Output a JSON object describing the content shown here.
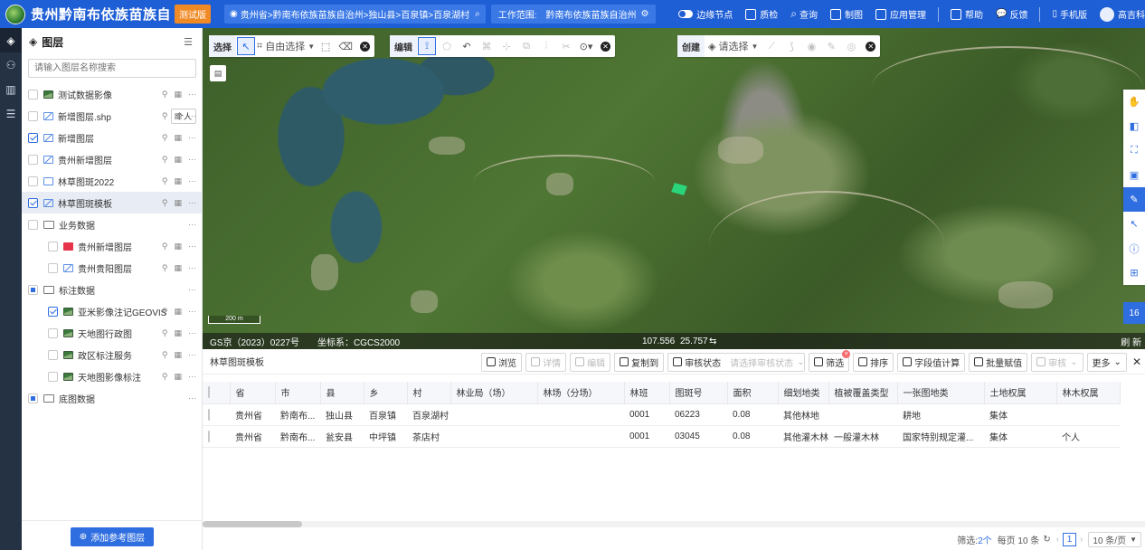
{
  "header": {
    "app_title": "贵州黔南布依族苗族自",
    "test_badge": "测试版",
    "region_path": "贵州省>黔南布依族苗族自治州>独山县>百泉镇>百泉湖村",
    "work_scope_label": "工作范围:",
    "work_scope_value": "黔南布依族苗族自治州",
    "edge_node_label": "边缘节点",
    "menu": [
      "质检",
      "查询",
      "制图",
      "应用管理"
    ],
    "help": "帮助",
    "feedback": "反馈",
    "mobile": "手机版",
    "user": "高吉科"
  },
  "layer_panel": {
    "title": "图层",
    "search_placeholder": "请输入图层名称搜索",
    "layers": [
      {
        "name": "测试数据影像",
        "checked": false,
        "icon": "image",
        "indent": 0
      },
      {
        "name": "新增图层.shp",
        "checked": false,
        "icon": "vector",
        "indent": 0,
        "tag": "个人"
      },
      {
        "name": "新增图层",
        "checked": true,
        "icon": "vector",
        "indent": 0
      },
      {
        "name": "贵州新增图层",
        "checked": false,
        "icon": "vector",
        "indent": 0
      },
      {
        "name": "林草图斑2022",
        "checked": false,
        "icon": "plain",
        "indent": 0
      },
      {
        "name": "林草图斑模板",
        "checked": true,
        "icon": "vector",
        "indent": 0,
        "selected": true
      },
      {
        "name": "业务数据",
        "checked": false,
        "icon": "folder",
        "indent": 0,
        "group": true
      },
      {
        "name": "贵州新增图层",
        "checked": false,
        "icon": "red",
        "indent": 1
      },
      {
        "name": "贵州贵阳图层",
        "checked": false,
        "icon": "vector",
        "indent": 1
      },
      {
        "name": "标注数据",
        "checked": "partial",
        "icon": "folder",
        "indent": 0,
        "group": true
      },
      {
        "name": "亚米影像注记GEOVIS",
        "checked": true,
        "icon": "image",
        "indent": 1
      },
      {
        "name": "天地图行政图",
        "checked": false,
        "icon": "image",
        "indent": 1
      },
      {
        "name": "政区标注服务",
        "checked": false,
        "icon": "image",
        "indent": 1
      },
      {
        "name": "天地图影像标注",
        "checked": false,
        "icon": "image",
        "indent": 1
      },
      {
        "name": "底图数据",
        "checked": "partial",
        "icon": "folder",
        "indent": 0,
        "group": true
      }
    ],
    "add_ref_button": "添加参考图层"
  },
  "map_toolbar": {
    "select_label": "选择",
    "free_select": "自由选择",
    "edit_label": "编辑",
    "create_label": "创建",
    "create_select": "请选择"
  },
  "map_status": {
    "scale": "200 m",
    "license": "GS京（2023）0227号",
    "crs": "坐标系：CGCS2000",
    "lon": "107.556",
    "lat": "25.757",
    "right_text": "刷 新"
  },
  "right_tools": {
    "badge": "16"
  },
  "table_panel": {
    "title": "林草图斑模板",
    "actions": [
      {
        "label": "浏览",
        "disabled": false
      },
      {
        "label": "详情",
        "disabled": true
      },
      {
        "label": "编辑",
        "disabled": true
      },
      {
        "label": "复制到",
        "disabled": false
      },
      {
        "label": "审核状态",
        "disabled": false
      },
      {
        "label": "请选择审核状态",
        "disabled": true
      },
      {
        "label": "筛选",
        "disabled": false
      },
      {
        "label": "排序",
        "disabled": false
      },
      {
        "label": "字段值计算",
        "disabled": false
      },
      {
        "label": "批量赋值",
        "disabled": false
      },
      {
        "label": "审核",
        "disabled": true
      },
      {
        "label": "更多",
        "disabled": false
      }
    ],
    "filter_badge": "×",
    "columns": [
      "省",
      "市",
      "县",
      "乡",
      "村",
      "林业局（场）",
      "林场（分场）",
      "林班",
      "图斑号",
      "面积",
      "细划地类",
      "植被覆盖类型",
      "一张图地类",
      "土地权属",
      "林木权属"
    ],
    "rows": [
      [
        "贵州省",
        "黔南布...",
        "独山县",
        "百泉镇",
        "百泉湖村",
        "",
        "",
        "0001",
        "06223",
        "0.08",
        "其他林地",
        "",
        "耕地",
        "集体",
        ""
      ],
      [
        "贵州省",
        "黔南布...",
        "瓮安县",
        "中坪镇",
        "茶店村",
        "",
        "",
        "0001",
        "03045",
        "0.08",
        "其他灌木林地",
        "一般灌木林",
        "国家特别规定灌...",
        "集体",
        "个人"
      ]
    ],
    "pager": {
      "filter_label": "筛选:",
      "filter_count": "2个",
      "per_page_text": "每页 10 条",
      "current_page": "1",
      "page_size": "10 条/页"
    }
  }
}
